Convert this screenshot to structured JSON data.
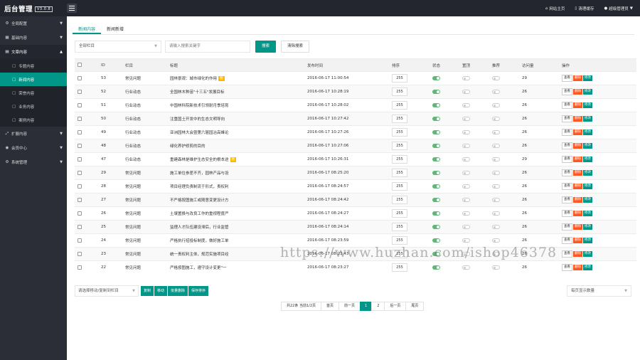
{
  "app": {
    "title": "后台管理",
    "version": "V3.0.8"
  },
  "topbar": {
    "links": [
      {
        "icon": "home-icon",
        "label": "网站主页"
      },
      {
        "icon": "trash-icon",
        "label": "清理缓存"
      },
      {
        "icon": "user-icon",
        "label": "超级管理员"
      }
    ]
  },
  "sidebar": {
    "items": [
      {
        "icon": "gear-icon",
        "label": "全局配置",
        "open": false
      },
      {
        "icon": "grid-icon",
        "label": "基础内容",
        "open": false
      },
      {
        "icon": "doc-icon",
        "label": "文章内容",
        "open": true,
        "children": [
          {
            "label": "专题内容",
            "active": false
          },
          {
            "label": "新闻内容",
            "active": true
          },
          {
            "label": "荣誉内容",
            "active": false
          },
          {
            "label": "业务内容",
            "active": false
          },
          {
            "label": "案例内容",
            "active": false
          }
        ]
      },
      {
        "icon": "expand-icon",
        "label": "扩展内容",
        "open": false
      },
      {
        "icon": "users-icon",
        "label": "会员中心",
        "open": false
      },
      {
        "icon": "settings-icon",
        "label": "系统管理",
        "open": false
      }
    ]
  },
  "tabs": [
    {
      "label": "新闻内容",
      "active": true
    },
    {
      "label": "新闻新增",
      "active": false
    }
  ],
  "filters": {
    "column_select": "全部栏目",
    "search_placeholder": "请输入搜索关键字",
    "search_button": "搜索",
    "clear_button": "清除搜索"
  },
  "table": {
    "headers": [
      "",
      "ID",
      "栏目",
      "标题",
      "发布时间",
      "排序",
      "状态",
      "置顶",
      "推荐",
      "访问量",
      "操作"
    ],
    "rows": [
      {
        "id": "53",
        "column": "常见问题",
        "title": "园林景观：城市绿化的作用",
        "badge": "图",
        "time": "2016-06-17 11:00:54",
        "sort": "255",
        "status": true,
        "top": false,
        "rec": false,
        "views": "29"
      },
      {
        "id": "52",
        "column": "行业动态",
        "title": "全国林木种苗\"十三五\"发展目标",
        "badge": "",
        "time": "2016-06-17 10:28:19",
        "sort": "255",
        "status": true,
        "top": false,
        "rec": false,
        "views": "26"
      },
      {
        "id": "51",
        "column": "行业动态",
        "title": "中国林科院新技术引领耐月季培育",
        "badge": "",
        "time": "2016-06-17 10:28:02",
        "sort": "255",
        "status": true,
        "top": false,
        "rec": false,
        "views": "26"
      },
      {
        "id": "50",
        "column": "行业动态",
        "title": "注重国土开发中的生态文明导向",
        "badge": "",
        "time": "2016-06-17 10:27:42",
        "sort": "255",
        "status": true,
        "top": false,
        "rec": false,
        "views": "26"
      },
      {
        "id": "49",
        "column": "行业动态",
        "title": "亚洲园林大会暨第六届园冶高峰论",
        "badge": "",
        "time": "2016-06-17 10:27:26",
        "sort": "255",
        "status": true,
        "top": false,
        "rec": false,
        "views": "26"
      },
      {
        "id": "48",
        "column": "行业动态",
        "title": "绿化养护修剪的目的",
        "badge": "",
        "time": "2016-06-17 10:27:06",
        "sort": "255",
        "status": true,
        "top": false,
        "rec": false,
        "views": "26"
      },
      {
        "id": "47",
        "column": "行业动态",
        "title": "重建森林是维护生态安全的根本途",
        "badge": "图",
        "time": "2016-06-17 10:26:31",
        "sort": "255",
        "status": true,
        "top": false,
        "rec": false,
        "views": "29"
      },
      {
        "id": "29",
        "column": "常见问题",
        "title": "施工单位参差不齐，园林产品与设",
        "badge": "",
        "time": "2016-06-17 08:25:20",
        "sort": "255",
        "status": true,
        "top": false,
        "rec": false,
        "views": "26"
      },
      {
        "id": "28",
        "column": "常见问题",
        "title": "项目经理负责制流于形式，责权利",
        "badge": "",
        "time": "2016-06-17 08:24:57",
        "sort": "255",
        "status": true,
        "top": false,
        "rec": false,
        "views": "26"
      },
      {
        "id": "27",
        "column": "常见问题",
        "title": "不严格按图施工或随意变更设计方",
        "badge": "",
        "time": "2016-06-17 08:24:42",
        "sort": "255",
        "status": true,
        "top": false,
        "rec": false,
        "views": "26"
      },
      {
        "id": "26",
        "column": "常见问题",
        "title": "土壤置换与改良工作的重视程度严",
        "badge": "",
        "time": "2016-06-17 08:24:27",
        "sort": "255",
        "status": true,
        "top": false,
        "rec": false,
        "views": "26"
      },
      {
        "id": "25",
        "column": "常见问题",
        "title": "监理人才队伍建设滞后，行业监管",
        "badge": "",
        "time": "2016-06-17 08:24:14",
        "sort": "255",
        "status": true,
        "top": false,
        "rec": false,
        "views": "26"
      },
      {
        "id": "24",
        "column": "常见问题",
        "title": "严格执行招投标制度，做好施工单",
        "badge": "",
        "time": "2016-06-17 08:23:59",
        "sort": "255",
        "status": true,
        "top": false,
        "rec": false,
        "views": "26"
      },
      {
        "id": "23",
        "column": "常见问题",
        "title": "统一责权利主体，规范实施项目经",
        "badge": "",
        "time": "2016-06-17 08:23:43",
        "sort": "255",
        "status": true,
        "top": false,
        "rec": false,
        "views": "26"
      },
      {
        "id": "22",
        "column": "常见问题",
        "title": "严格按图施工，遵守设计变更\"一",
        "badge": "",
        "time": "2016-06-17 08:23:27",
        "sort": "255",
        "status": true,
        "top": false,
        "rec": false,
        "views": "26"
      }
    ],
    "ops": {
      "view": "查看",
      "delete": "删除",
      "edit": "修改"
    }
  },
  "bottom": {
    "move_select": "请选择移动/复制到栏目",
    "buttons": [
      "复制",
      "移动",
      "批量删除",
      "保存排序"
    ],
    "per_page": "每页显示数量"
  },
  "pager": {
    "summary": "共22条 当前1/2页",
    "first": "首页",
    "prev": "前一页",
    "pages": [
      "1",
      "2"
    ],
    "current": "1",
    "next": "后一页",
    "last": "尾页"
  },
  "watermark": "https://www.huzhan.com/ishop46378"
}
